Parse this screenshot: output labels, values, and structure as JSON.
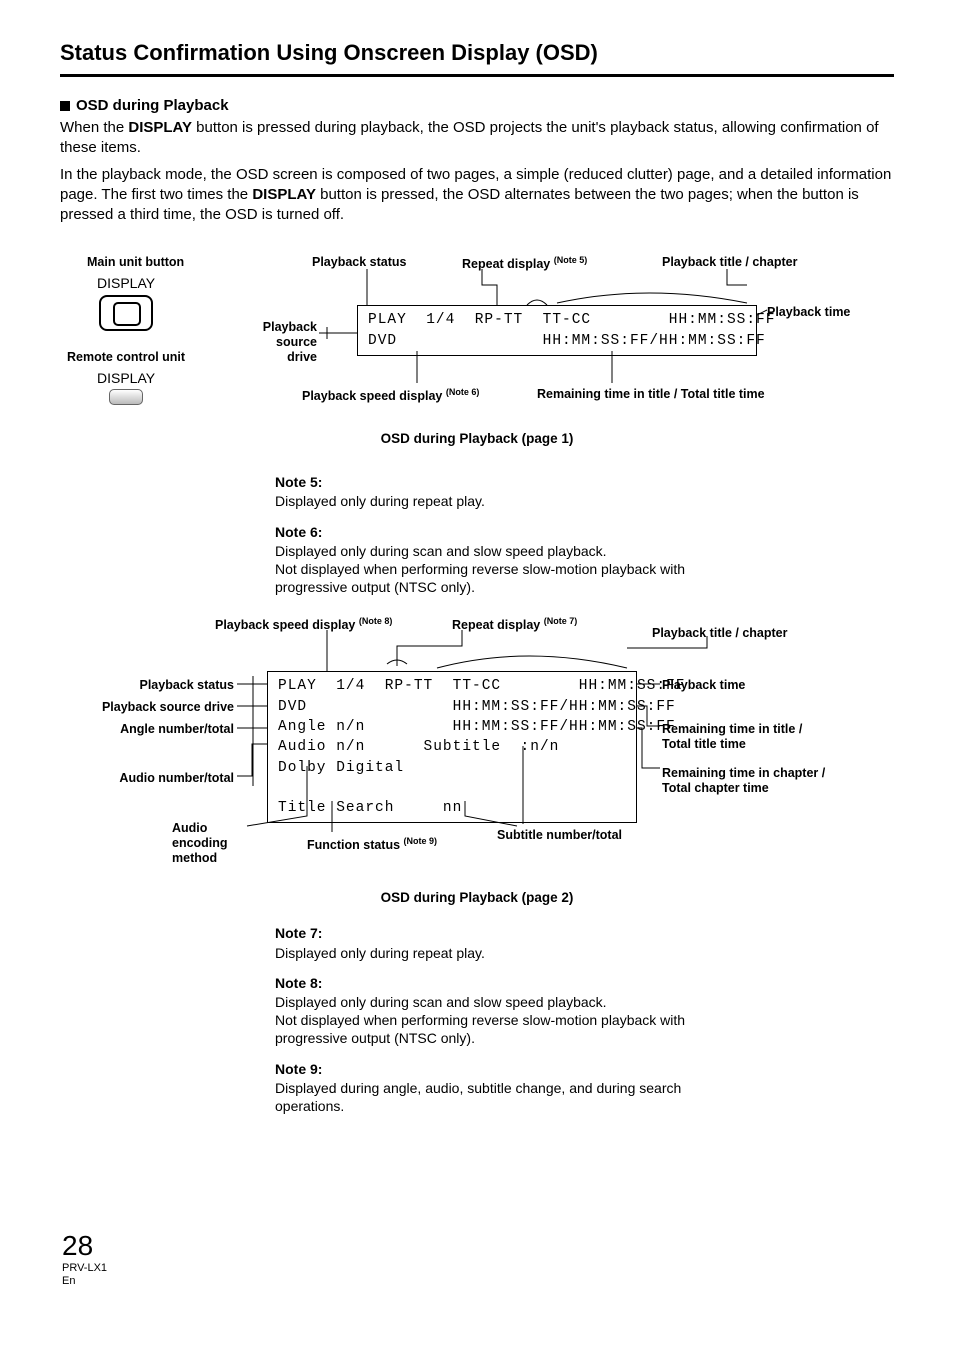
{
  "title": "Status Confirmation Using Onscreen Display (OSD)",
  "section_header": "OSD during Playback",
  "para1a": "When the ",
  "para1b": " button is pressed during playback, the OSD projects the unit's playback status, allowing confirmation of these items.",
  "para2a": "In the playback mode, the OSD screen is composed of two pages, a simple (reduced clutter) page, and a detailed information page. The first two times the ",
  "para2b": " button is pressed, the OSD alternates between the two pages; when the button is pressed a third time, the OSD is turned off.",
  "display_word": "DISPLAY",
  "lbl_main_unit": "Main unit button",
  "lbl_remote_unit": "Remote control unit",
  "lbl_display_btn": "DISPLAY",
  "d1": {
    "playback_status": "Playback status",
    "repeat_display": "Repeat display ",
    "note5sup": "(Note 5)",
    "playback_title_chapter": "Playback title / chapter",
    "playback_source_drive": "Playback source drive",
    "playback_speed_display": "Playback speed display ",
    "note6sup": "(Note 6)",
    "remaining_time": "Remaining time in title / Total title time",
    "playback_time": "Playback time",
    "osd_line1": "PLAY  1/4  RP-TT  TT-CC        HH:MM:SS:FF",
    "osd_line2": "DVD               HH:MM:SS:FF/HH:MM:SS:FF",
    "caption": "OSD during Playback (page 1)"
  },
  "note5_h": "Note 5:",
  "note5_b": "Displayed only during repeat play.",
  "note6_h": "Note 6:",
  "note6_b1": "Displayed only during scan and slow speed playback.",
  "note6_b2": "Not displayed when performing reverse slow-motion playback with progressive output (NTSC only).",
  "d2": {
    "playback_speed_display": "Playback speed display ",
    "note8sup": "(Note 8)",
    "repeat_display": "Repeat display ",
    "note7sup": "(Note 7)",
    "playback_title_chapter": "Playback title / chapter",
    "playback_status": "Playback status",
    "playback_source_drive": "Playback source drive",
    "angle_number": "Angle number/total",
    "audio_number": "Audio number/total",
    "audio_encoding": "Audio encoding method",
    "function_status": "Function status ",
    "note9sup": "(Note 9)",
    "subtitle_number": "Subtitle number/total",
    "playback_time": "Playback time",
    "remaining_title": "Remaining time in title / Total title time",
    "remaining_chapter": "Remaining time in chapter / Total chapter time",
    "osd_line1": "PLAY  1/4  RP-TT  TT-CC        HH:MM:SS:FF",
    "osd_line2": "DVD               HH:MM:SS:FF/HH:MM:SS:FF",
    "osd_line3": "Angle n/n         HH:MM:SS:FF/HH:MM:SS:FF",
    "osd_line4": "Audio n/n      Subtitle  :n/n",
    "osd_line5": "Dolby Digital",
    "osd_line6": "",
    "osd_line7": "Title Search     nn",
    "caption": "OSD during Playback (page 2)"
  },
  "note7_h": "Note 7:",
  "note7_b": "Displayed only during repeat play.",
  "note8_h": "Note 8:",
  "note8_b1": "Displayed only during scan and slow speed playback.",
  "note8_b2": "Not displayed when performing reverse slow-motion playback with progressive output (NTSC only).",
  "note9_h": "Note 9:",
  "note9_b": "Displayed during angle, audio, subtitle change, and during search operations.",
  "footer_page": "28",
  "footer_model": "PRV-LX1",
  "footer_lang": "En"
}
